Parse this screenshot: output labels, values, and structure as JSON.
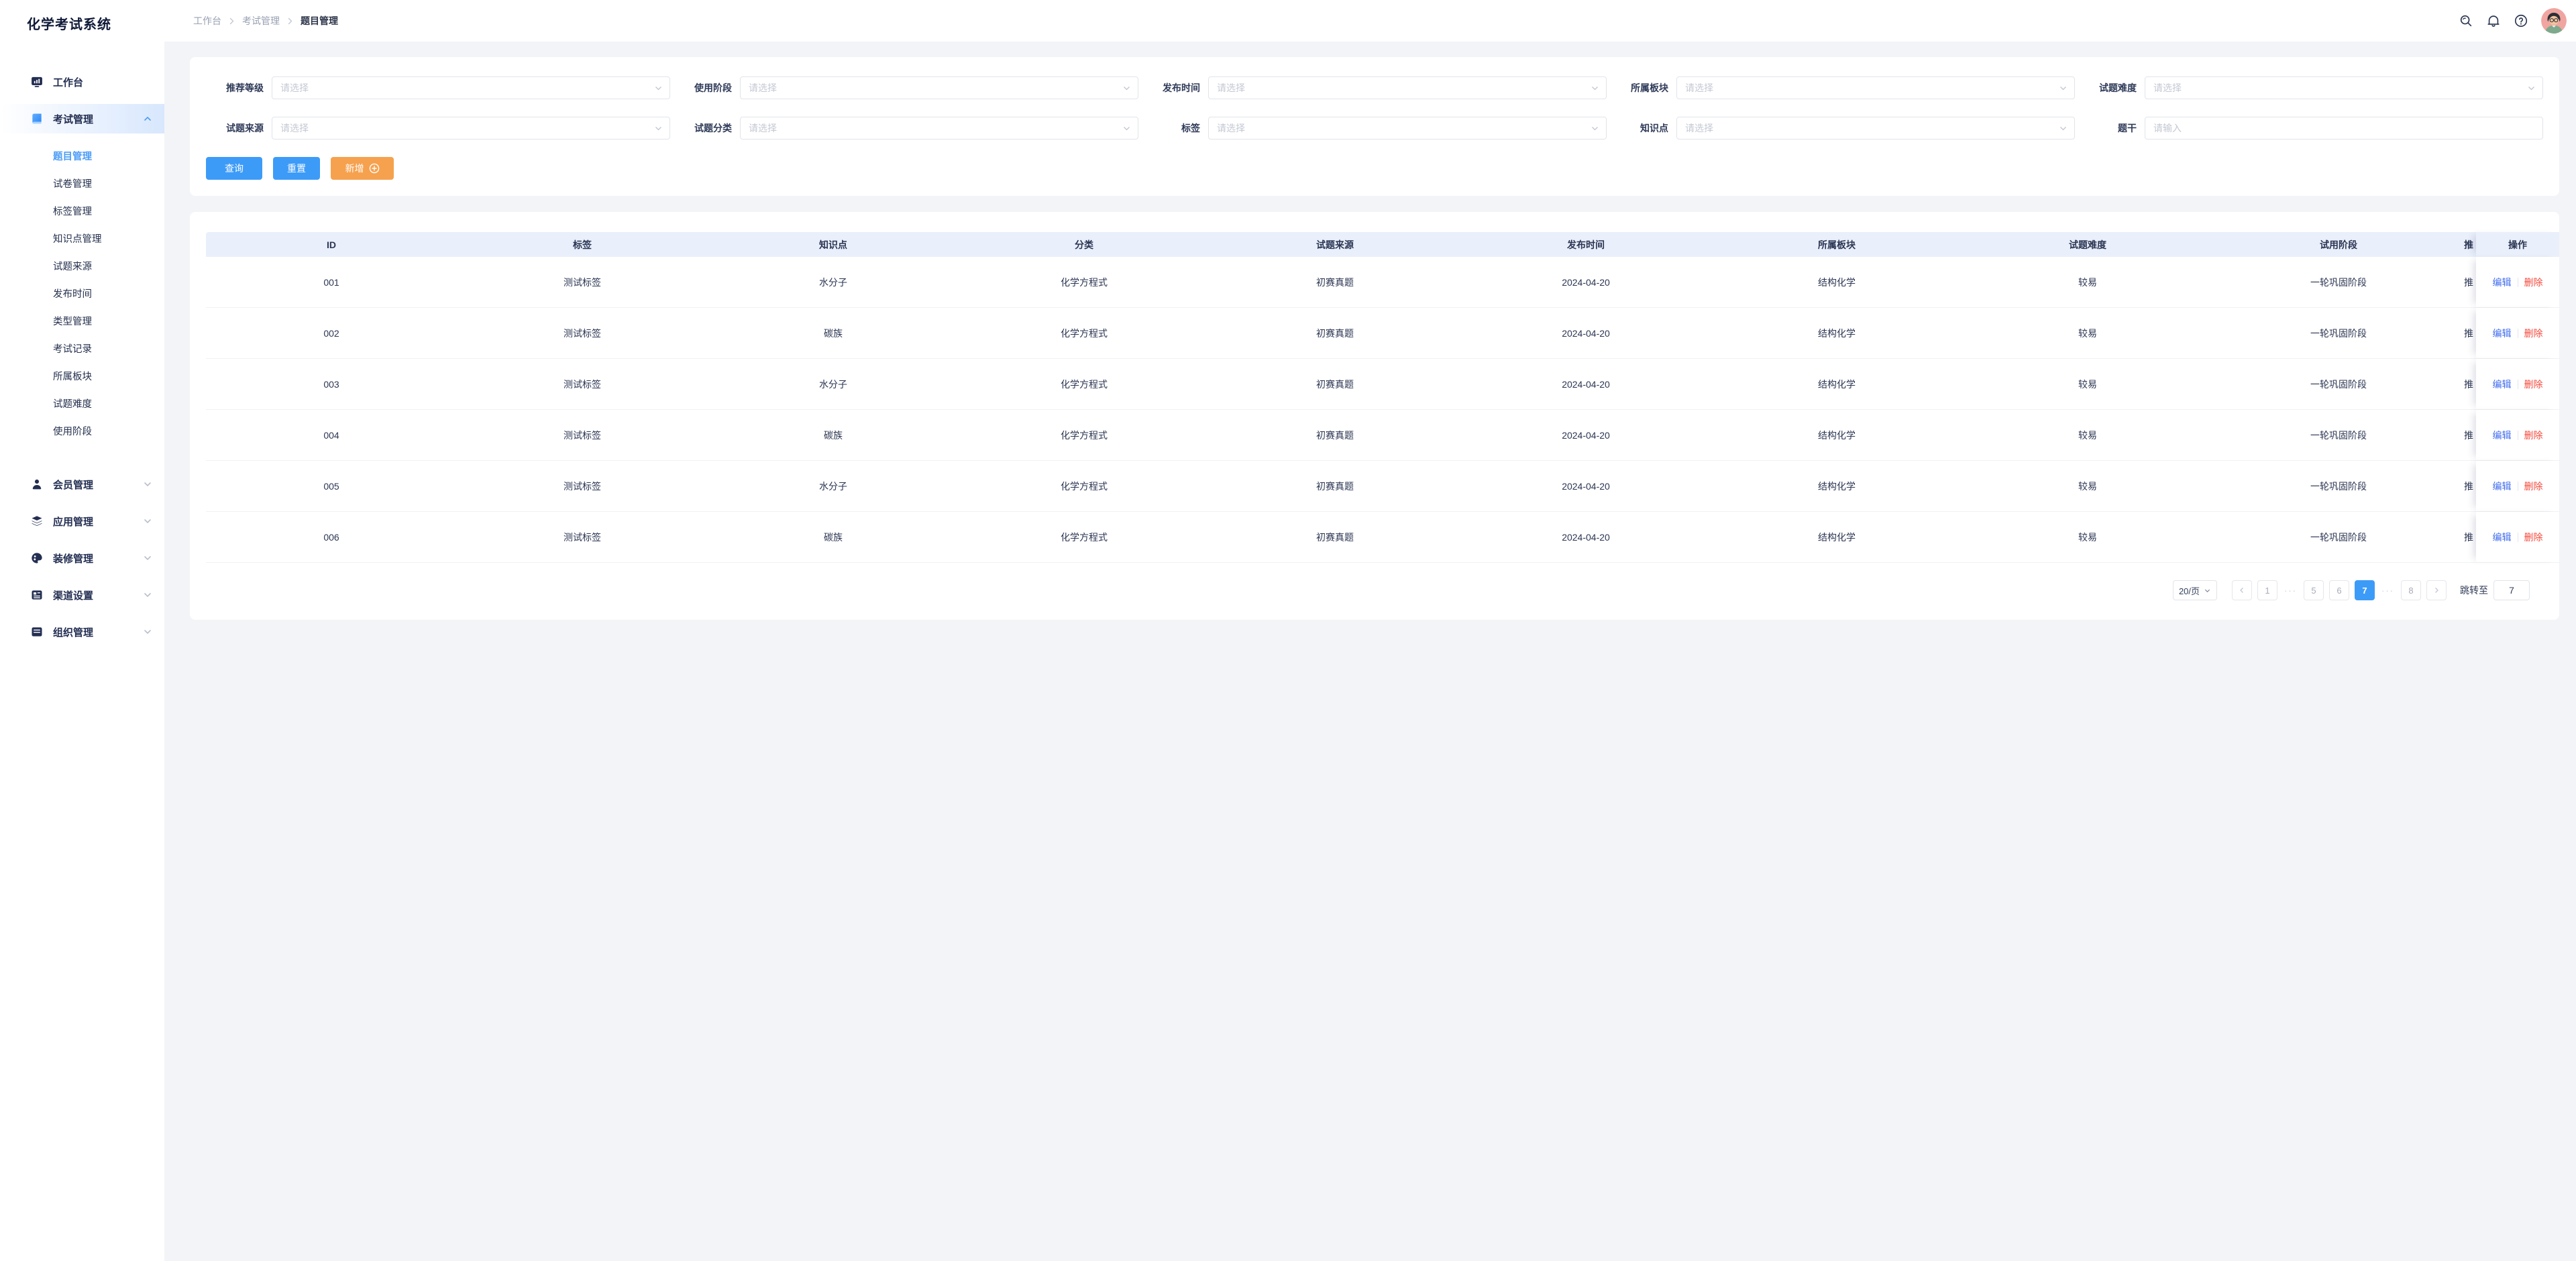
{
  "app": {
    "title": "化学考试系统"
  },
  "breadcrumb": {
    "items": [
      "工作台",
      "考试管理",
      "题目管理"
    ]
  },
  "topbar": {
    "icons": [
      "search-icon",
      "bell-icon",
      "help-icon"
    ],
    "avatar": "user-avatar"
  },
  "sidebar": {
    "items": [
      {
        "label": "工作台",
        "icon": "dashboard-icon"
      },
      {
        "label": "考试管理",
        "icon": "book-icon",
        "expanded": true,
        "children": [
          "题目管理",
          "试卷管理",
          "标签管理",
          "知识点管理",
          "试题来源",
          "发布时间",
          "类型管理",
          "考试记录",
          "所属板块",
          "试题难度",
          "使用阶段"
        ],
        "active_child": "题目管理"
      },
      {
        "label": "会员管理",
        "icon": "user-icon"
      },
      {
        "label": "应用管理",
        "icon": "layers-icon"
      },
      {
        "label": "装修管理",
        "icon": "palette-icon"
      },
      {
        "label": "渠道设置",
        "icon": "news-icon"
      },
      {
        "label": "组织管理",
        "icon": "doc-icon",
        "clipped": true
      }
    ]
  },
  "filters": {
    "placeholder_select": "请选择",
    "placeholder_input": "请输入",
    "rows": [
      [
        {
          "label": "推荐等级",
          "type": "select"
        },
        {
          "label": "使用阶段",
          "type": "select"
        },
        {
          "label": "发布时间",
          "type": "select"
        },
        {
          "label": "所属板块",
          "type": "select"
        },
        {
          "label": "试题难度",
          "type": "select"
        }
      ],
      [
        {
          "label": "试题来源",
          "type": "select"
        },
        {
          "label": "试题分类",
          "type": "select"
        },
        {
          "label": "标签",
          "type": "select"
        },
        {
          "label": "知识点",
          "type": "select"
        },
        {
          "label": "题干",
          "type": "input"
        }
      ]
    ],
    "buttons": {
      "search": "查询",
      "reset": "重置",
      "add": "新增"
    }
  },
  "table": {
    "columns": [
      "ID",
      "标签",
      "知识点",
      "分类",
      "试题来源",
      "发布时间",
      "所属板块",
      "试题难度",
      "试用阶段",
      "推",
      "操作"
    ],
    "actions": {
      "edit": "编辑",
      "delete": "删除"
    },
    "rows": [
      {
        "id": "001",
        "tag": "测试标签",
        "knowledge": "水分子",
        "category": "化学方程式",
        "source": "初赛真题",
        "publish": "2024-04-20",
        "module": "结构化学",
        "difficulty": "较易",
        "stage": "一轮巩固阶段",
        "recommend": "推"
      },
      {
        "id": "002",
        "tag": "测试标签",
        "knowledge": "碳族",
        "category": "化学方程式",
        "source": "初赛真题",
        "publish": "2024-04-20",
        "module": "结构化学",
        "difficulty": "较易",
        "stage": "一轮巩固阶段",
        "recommend": "推"
      },
      {
        "id": "003",
        "tag": "测试标签",
        "knowledge": "水分子",
        "category": "化学方程式",
        "source": "初赛真题",
        "publish": "2024-04-20",
        "module": "结构化学",
        "difficulty": "较易",
        "stage": "一轮巩固阶段",
        "recommend": "推"
      },
      {
        "id": "004",
        "tag": "测试标签",
        "knowledge": "碳族",
        "category": "化学方程式",
        "source": "初赛真题",
        "publish": "2024-04-20",
        "module": "结构化学",
        "difficulty": "较易",
        "stage": "一轮巩固阶段",
        "recommend": "推"
      },
      {
        "id": "005",
        "tag": "测试标签",
        "knowledge": "水分子",
        "category": "化学方程式",
        "source": "初赛真题",
        "publish": "2024-04-20",
        "module": "结构化学",
        "difficulty": "较易",
        "stage": "一轮巩固阶段",
        "recommend": "推"
      },
      {
        "id": "006",
        "tag": "测试标签",
        "knowledge": "碳族",
        "category": "化学方程式",
        "source": "初赛真题",
        "publish": "2024-04-20",
        "module": "结构化学",
        "difficulty": "较易",
        "stage": "一轮巩固阶段",
        "recommend": "推"
      }
    ]
  },
  "pagination": {
    "page_size": "20/页",
    "pages": [
      "1",
      "5",
      "6",
      "7",
      "8"
    ],
    "active": "7",
    "ellipsis": "···",
    "jump_label": "跳转至",
    "jump_value": "7"
  },
  "colors": {
    "accent_blue": "#3D9BF8",
    "accent_orange": "#F6A14E",
    "link_blue": "#3E6BF0",
    "danger_red": "#F4493C",
    "table_header_bg": "#E9EFFB",
    "page_bg": "#F3F4F8",
    "sidebar_text": "#232E52",
    "active_menu_text": "#4C9DF7"
  }
}
